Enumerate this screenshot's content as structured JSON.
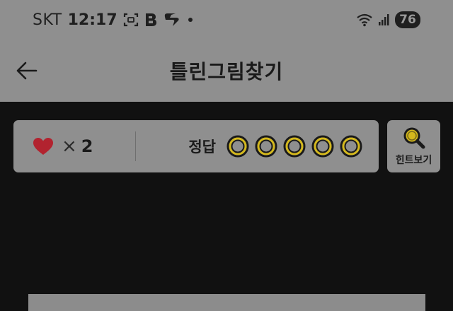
{
  "status_bar": {
    "carrier": "SKT",
    "time": "12:17",
    "battery": "76",
    "icons": [
      "screenshot-icon",
      "b-app-icon",
      "s-app-icon",
      "dot-icon",
      "wifi-icon",
      "signal-icon"
    ]
  },
  "header": {
    "title": "틀린그림찾기",
    "back_icon": "arrow-left-icon"
  },
  "score": {
    "lives_symbol": "×",
    "lives_count": "2",
    "answer_label": "정답",
    "answers_total": 5,
    "answers_found": 0
  },
  "hint": {
    "label": "힌트보기",
    "icon": "magnifier-icon"
  },
  "colors": {
    "overlay_gray": "#8f8f8f",
    "background": "#111111",
    "heart": "#b2232f",
    "ring_yellow": "#d4b81c",
    "text": "#1a1a1a"
  }
}
